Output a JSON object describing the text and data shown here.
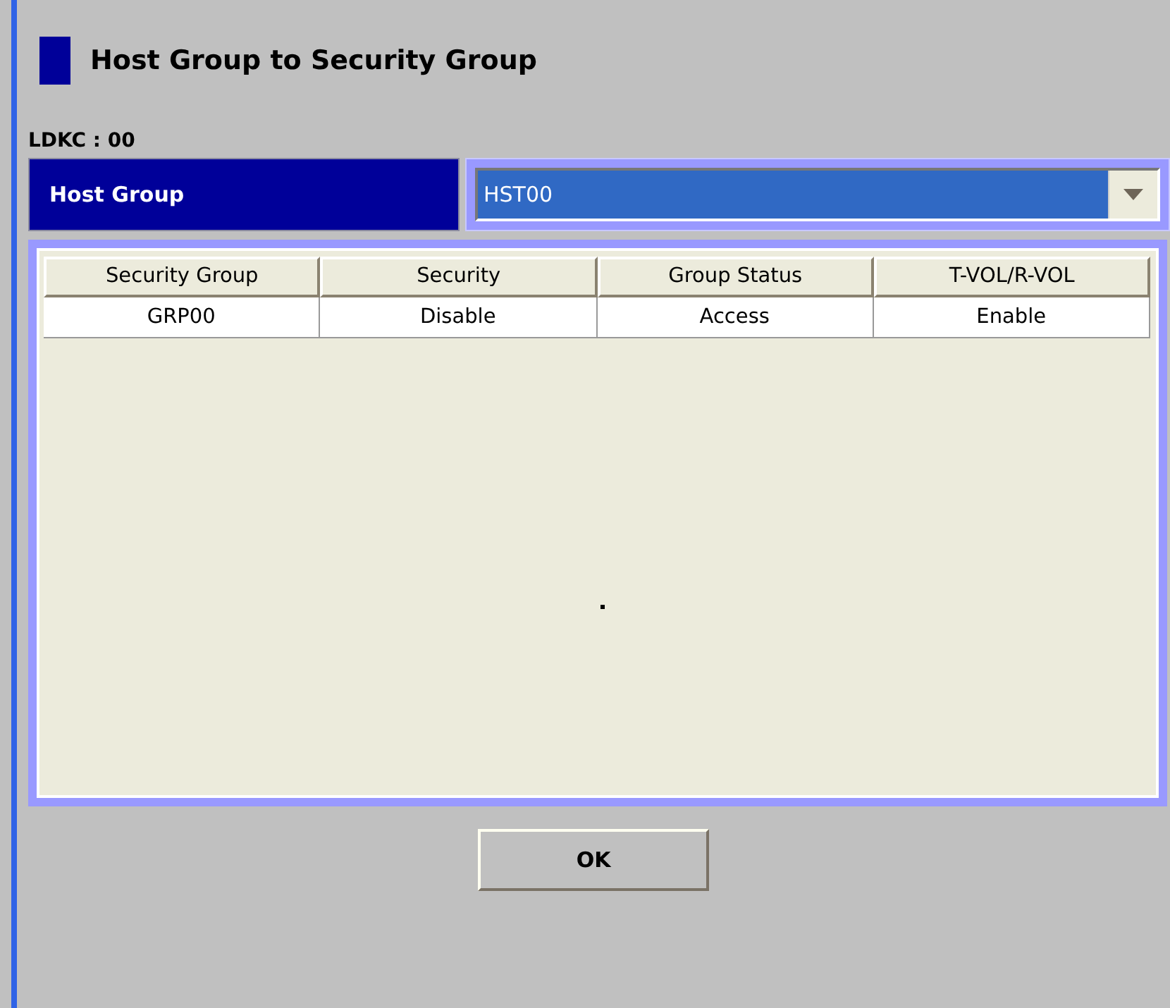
{
  "title": "Host Group to Security Group",
  "ldkc": "LDKC : 00",
  "host_group": {
    "label": "Host Group",
    "value": "HST00"
  },
  "table": {
    "columns": [
      "Security Group",
      "Security",
      "Group Status",
      "T-VOL/R-VOL"
    ],
    "rows": [
      [
        "GRP00",
        "Disable",
        "Access",
        "Enable"
      ]
    ]
  },
  "buttons": [
    "OK"
  ]
}
